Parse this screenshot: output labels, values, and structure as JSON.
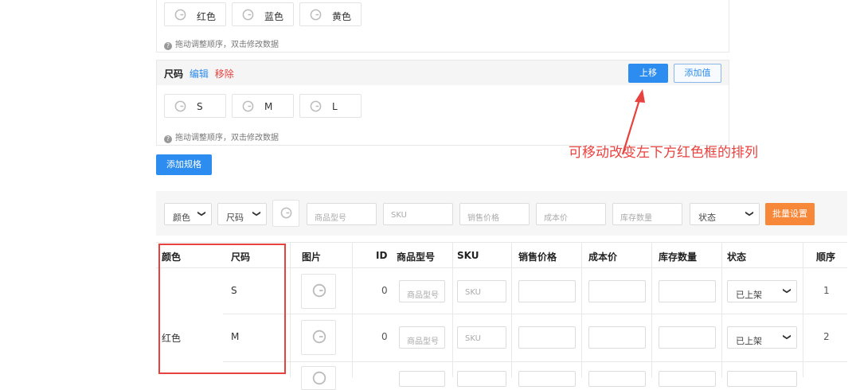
{
  "color_spec": {
    "values": [
      "红色",
      "蓝色",
      "黄色"
    ],
    "tip": "拖动调整顺序，双击修改数据"
  },
  "size_spec": {
    "name": "尺码",
    "edit_label": "编辑",
    "remove_label": "移除",
    "move_up_label": "上移",
    "add_value_label": "添加值",
    "values": [
      "S",
      "M",
      "L"
    ],
    "tip": "拖动调整顺序，双击修改数据"
  },
  "add_spec_label": "添加规格",
  "annotation": "可移动改变左下方红色框的排列",
  "batch_bar": {
    "color_select": "颜色",
    "size_select": "尺码",
    "model_placeholder": "商品型号",
    "sku_placeholder": "SKU",
    "price_placeholder": "销售价格",
    "cost_placeholder": "成本价",
    "stock_placeholder": "库存数量",
    "status_select": "状态",
    "batch_button": "批量设置"
  },
  "table": {
    "headers": [
      "颜色",
      "尺码",
      "图片",
      "ID",
      "商品型号",
      "SKU",
      "销售价格",
      "成本价",
      "库存数量",
      "状态",
      "顺序"
    ],
    "group_color": "红色",
    "rows": [
      {
        "size": "S",
        "id": "0",
        "model_placeholder": "商品型号",
        "sku_placeholder": "SKU",
        "status": "已上架",
        "order": "1"
      },
      {
        "size": "M",
        "id": "0",
        "model_placeholder": "商品型号",
        "sku_placeholder": "SKU",
        "status": "已上架",
        "order": "2"
      }
    ]
  },
  "colors": {
    "primary": "#2d8cf0",
    "danger": "#e8423f",
    "orange": "#f7883a"
  }
}
